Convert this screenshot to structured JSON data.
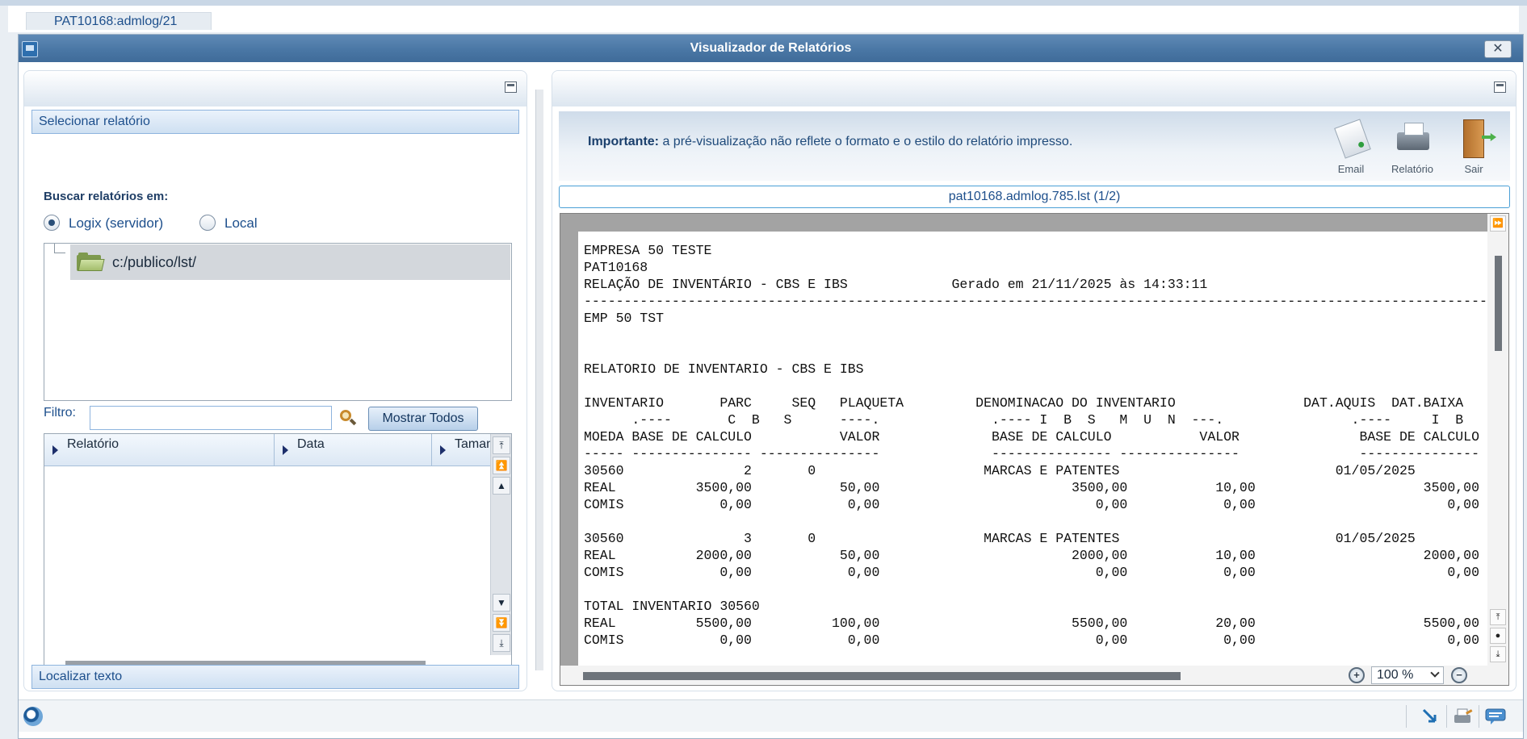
{
  "tab": {
    "label": "PAT10168:admlog/21"
  },
  "window": {
    "title": "Visualizador de Relatórios",
    "close_label": "✕"
  },
  "left": {
    "section_select": "Selecionar relatório",
    "search_in_label": "Buscar relatórios em:",
    "radio_options": [
      {
        "label": "Logix (servidor)",
        "selected": true
      },
      {
        "label": "Local",
        "selected": false
      }
    ],
    "tree": {
      "path": "c:/publico/lst/",
      "icon": "folder-icon"
    },
    "filter": {
      "label": "Filtro:",
      "value": "",
      "placeholder": ""
    },
    "show_all_button": "Mostrar Todos",
    "grid_columns": [
      "Relatório",
      "Data",
      "Tamanho"
    ],
    "section_find": "Localizar texto"
  },
  "right": {
    "notice_bold": "Importante:",
    "notice_text": " a pré-visualização não reflete o formato e o estilo do relatório impresso.",
    "toolbar": [
      {
        "label": "Email",
        "icon": "email-icon"
      },
      {
        "label": "Relatório",
        "icon": "printer-icon"
      },
      {
        "label": "Sair",
        "icon": "exit-door-icon"
      }
    ],
    "file_name": "pat10168.admlog.785.lst (1/2)",
    "report_lines": [
      "EMPRESA 50 TESTE",
      "PAT10168",
      "RELAÇÃO DE INVENTÁRIO - CBS E IBS             Gerado em 21/11/2025 às 14:33:11",
      "--------------------------------------------------------------------------------------------------------------------------------",
      "EMP 50 TST",
      "",
      "",
      "RELATORIO DE INVENTARIO - CBS E IBS",
      "",
      "INVENTARIO       PARC     SEQ   PLAQUETA         DENOMINACAO DO INVENTARIO                DAT.AQUIS  DAT.BAIXA",
      "      .----       C  B   S      ----.              .---- I  B  S   M  U  N  ---.                .----     I  B",
      "MOEDA BASE DE CALCULO           VALOR              BASE DE CALCULO           VALOR               BASE DE CALCULO",
      "----- --------------- ---------------              --------------- ---------------               ---------------",
      "30560               2       0                     MARCAS E PATENTES                           01/05/2025",
      "REAL          3500,00           50,00                        3500,00           10,00                     3500,00",
      "COMIS            0,00            0,00                           0,00            0,00                        0,00",
      "",
      "30560               3       0                     MARCAS E PATENTES                           01/05/2025",
      "REAL          2000,00           50,00                        2000,00           10,00                     2000,00",
      "COMIS            0,00            0,00                           0,00            0,00                        0,00",
      "",
      "TOTAL INVENTARIO 30560",
      "REAL          5500,00          100,00                        5500,00           20,00                     5500,00",
      "COMIS            0,00            0,00                           0,00            0,00                        0,00"
    ],
    "zoom": "100 %"
  }
}
